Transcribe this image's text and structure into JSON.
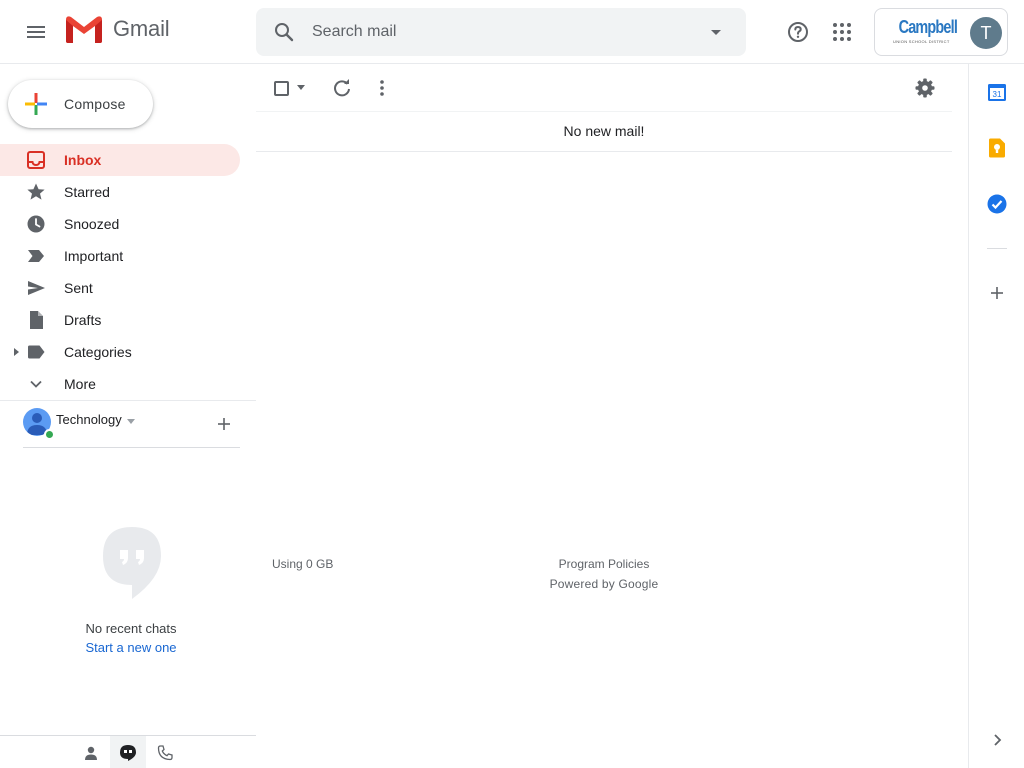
{
  "header": {
    "app_name": "Gmail",
    "search": {
      "placeholder": "Search mail"
    },
    "account": {
      "org_name": "Campbell",
      "org_subtitle": "UNION SCHOOL DISTRICT",
      "avatar_initial": "T"
    }
  },
  "sidebar": {
    "compose_label": "Compose",
    "items": [
      {
        "label": "Inbox",
        "icon": "inbox-icon",
        "active": true
      },
      {
        "label": "Starred",
        "icon": "star-icon"
      },
      {
        "label": "Snoozed",
        "icon": "clock-icon"
      },
      {
        "label": "Important",
        "icon": "important-icon"
      },
      {
        "label": "Sent",
        "icon": "send-icon"
      },
      {
        "label": "Drafts",
        "icon": "draft-icon"
      },
      {
        "label": "Categories",
        "icon": "label-icon"
      },
      {
        "label": "More",
        "icon": "chevron-down-icon"
      }
    ],
    "hangouts": {
      "user_name": "Technology",
      "empty_text": "No recent chats",
      "start_link": "Start a new one"
    }
  },
  "main": {
    "empty_message": "No new mail!",
    "storage": "Using 0 GB",
    "footer_policies": "Program Policies",
    "footer_powered": "Powered by Google"
  },
  "colors": {
    "accent_red": "#d93025",
    "active_bg": "#fce8e6",
    "link_blue": "#1967d2"
  }
}
